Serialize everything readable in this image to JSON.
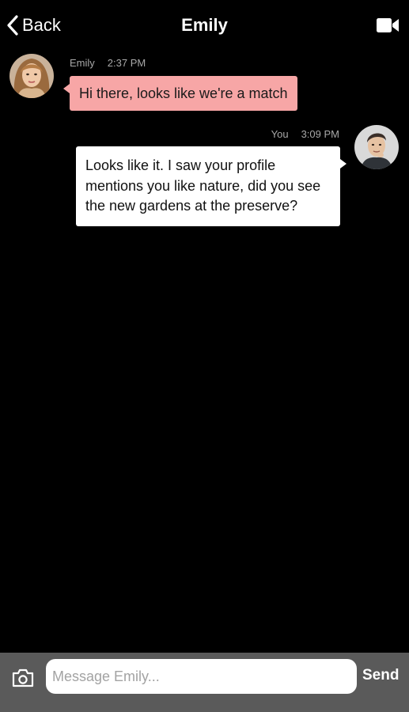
{
  "header": {
    "back_label": "Back",
    "title": "Emily",
    "back_icon": "chevron-left-icon",
    "video_icon": "video-camera-icon"
  },
  "messages": [
    {
      "sender": "Emily",
      "time": "2:37 PM",
      "text": "Hi there, looks like we're a match",
      "direction": "incoming",
      "bubble_color": "#f7a6a6"
    },
    {
      "sender": "You",
      "time": "3:09 PM",
      "text": "Looks like it. I saw your profile mentions you like nature, did you see the new gardens at the preserve?",
      "direction": "outgoing",
      "bubble_color": "#ffffff"
    }
  ],
  "composer": {
    "placeholder": "Message Emily...",
    "value": "",
    "send_label": "Send",
    "camera_icon": "camera-icon",
    "bar_color": "#5a5a5a"
  },
  "colors": {
    "background": "#000000",
    "meta_text": "#a8a8a8"
  }
}
